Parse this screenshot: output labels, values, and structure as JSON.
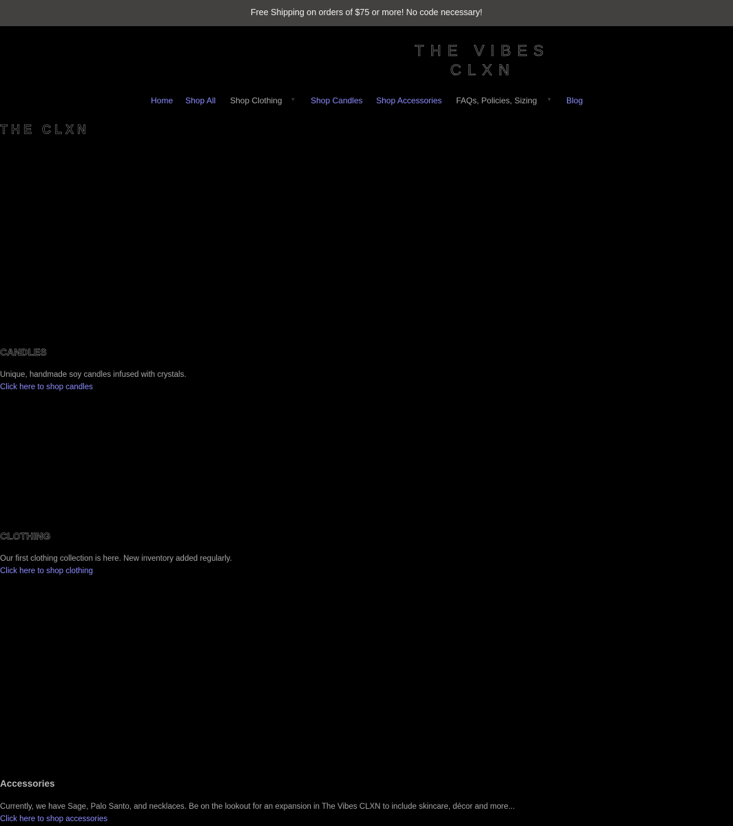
{
  "announcement": {
    "text": "Free Shipping on orders of $75 or more! No code necessary!"
  },
  "logo": {
    "line1": "THE VIBES",
    "line2": "CLXN"
  },
  "nav": {
    "home": "Home",
    "shop_all": "Shop All",
    "shop_clothing": "Shop Clothing",
    "shop_candles": "Shop Candles",
    "shop_accessories": "Shop Accessories",
    "faqs": "FAQs, Policies, Sizing",
    "blog": "Blog"
  },
  "hero": {
    "title": "THE CLXN"
  },
  "sections": {
    "candles": {
      "title": "CANDLES",
      "description": "Unique, handmade soy candles infused with crystals.",
      "link": "Click here to shop candles"
    },
    "clothing": {
      "title": "CLOTHING",
      "description": "Our first clothing collection is here. New inventory added regularly.",
      "link": "Click here to shop clothing"
    },
    "accessories": {
      "title": "Accessories",
      "description": "Currently, we have Sage, Palo Santo, and necklaces. Be on the lookout for an expansion in The Vibes CLXN to include skincare, décor and more...",
      "link": "Click here to shop accessories"
    }
  },
  "colors": {
    "background": "#000000",
    "announcement_bar": "#434040",
    "link": "#8d8dff",
    "text": "#a6a6a6"
  }
}
